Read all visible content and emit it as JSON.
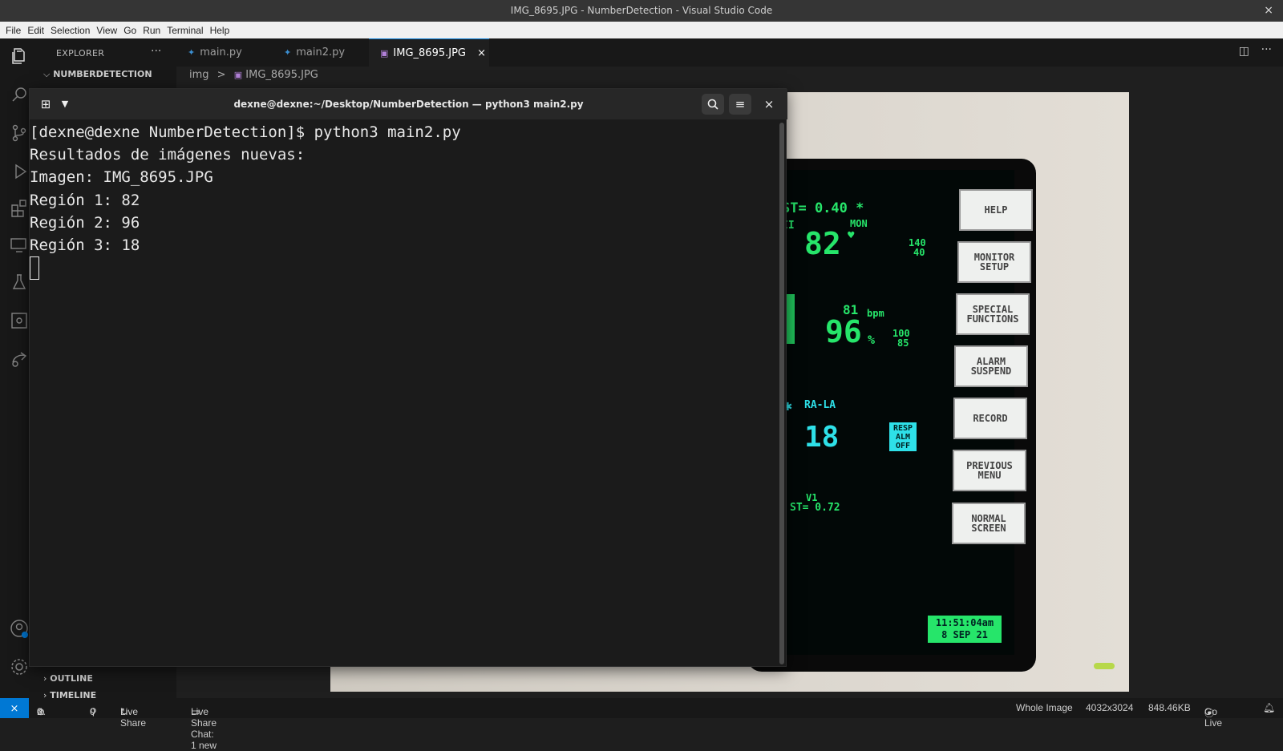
{
  "window": {
    "title": "IMG_8695.JPG - NumberDetection - Visual Studio Code",
    "close": "×"
  },
  "menu": [
    "File",
    "Edit",
    "Selection",
    "View",
    "Go",
    "Run",
    "Terminal",
    "Help"
  ],
  "sidebar": {
    "title": "EXPLORER",
    "more": "···",
    "folder": "NUMBERDETECTION",
    "outline": "OUTLINE",
    "timeline": "TIMELINE"
  },
  "tabs": [
    {
      "label": "main.py",
      "icon": "python-file-icon"
    },
    {
      "label": "main2.py",
      "icon": "python-file-icon"
    },
    {
      "label": "IMG_8695.JPG",
      "icon": "image-file-icon",
      "close": "×"
    }
  ],
  "breadcrumb": {
    "folder": "img",
    "sep": ">",
    "file": "IMG_8695.JPG"
  },
  "terminal": {
    "title": "dexne@dexne:~/Desktop/NumberDetection — python3 main2.py",
    "lines": [
      "[dexne@dexne NumberDetection]$ python3 main2.py",
      "Resultados de imágenes nuevas:",
      "Imagen: IMG_8695.JPG",
      "Región 1: 82",
      "Región 2: 96",
      "Región 3: 18"
    ],
    "close": "×"
  },
  "monitor": {
    "st_top": "ST= 0.40 *",
    "lead": "II",
    "mon": "MON",
    "hr": "82",
    "hr_hi": "140",
    "hr_lo": "40",
    "pulse": "81",
    "bpm": "bpm",
    "spo2": "96",
    "pct": "%",
    "spo2_hi": "100",
    "spo2_lo": "85",
    "ralA": "RA-LA",
    "resp": "18",
    "resp_alm": "RESP\nALM\nOFF",
    "v1": "V1",
    "st_bottom": "ST= 0.72",
    "time": "11:51:04am",
    "date": "8 SEP 21",
    "buttons": [
      "HELP",
      "MONITOR\nSETUP",
      "SPECIAL\nFUNCTIONS",
      "ALARM\nSUSPEND",
      "RECORD",
      "PREVIOUS\nMENU",
      "NORMAL\nSCREEN"
    ]
  },
  "status": {
    "errors": "0",
    "warnings": "0",
    "ports": "0",
    "live_share": "Live Share",
    "chat": "Live Share Chat: 1 new",
    "view": "Whole Image",
    "dimensions": "4032x3024",
    "size": "848.46KB",
    "go_live": "Go Live"
  }
}
